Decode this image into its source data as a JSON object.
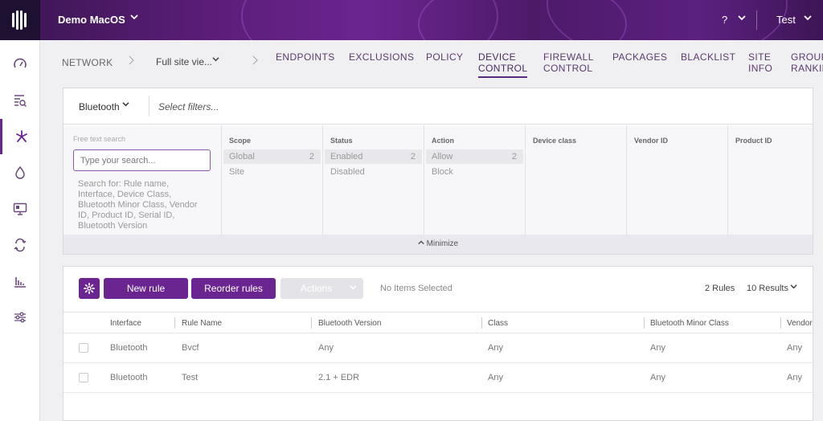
{
  "topbar": {
    "site_name": "Demo MacOS",
    "help": "?",
    "user": "Test"
  },
  "sidebar": {
    "items": [
      {
        "icon": "dashboard-gauge-icon"
      },
      {
        "icon": "search-list-icon"
      },
      {
        "icon": "sentinel-asterisk-icon",
        "active": true
      },
      {
        "icon": "droplet-icon"
      },
      {
        "icon": "monitor-icon"
      },
      {
        "icon": "sync-arrows-icon"
      },
      {
        "icon": "bar-chart-icon"
      },
      {
        "icon": "sliders-icon"
      }
    ]
  },
  "nav": {
    "network": "NETWORK",
    "site_selector": "Full site vie...",
    "tabs": [
      {
        "line1": "ENDPOINTS",
        "line2": ""
      },
      {
        "line1": "EXCLUSIONS",
        "line2": ""
      },
      {
        "line1": "POLICY",
        "line2": ""
      },
      {
        "line1": "DEVICE",
        "line2": "CONTROL",
        "active": true
      },
      {
        "line1": "FIREWALL",
        "line2": "CONTROL"
      },
      {
        "line1": "PACKAGES",
        "line2": ""
      },
      {
        "line1": "BLACKLIST",
        "line2": ""
      },
      {
        "line1": "SITE",
        "line2": "INFO"
      },
      {
        "line1": "GROUP",
        "line2": "RANKIN"
      }
    ]
  },
  "filters": {
    "interface_selector": "Bluetooth",
    "select_placeholder": "Select filters...",
    "free_text_label": "Free text search",
    "search_placeholder": "Type your search...",
    "search_help": "Search for: Rule name, Interface, Device Class, Bluetooth Minor Class, Vendor ID, Product ID, Serial ID, Bluetooth Version",
    "columns": {
      "scope": {
        "title": "Scope",
        "rows": [
          {
            "label": "Global",
            "count": "2",
            "selected": true
          },
          {
            "label": "Site",
            "count": ""
          }
        ]
      },
      "status": {
        "title": "Status",
        "rows": [
          {
            "label": "Enabled",
            "count": "2",
            "selected": true
          },
          {
            "label": "Disabled",
            "count": ""
          }
        ]
      },
      "action": {
        "title": "Action",
        "rows": [
          {
            "label": "Allow",
            "count": "2",
            "selected": true
          },
          {
            "label": "Block",
            "count": ""
          }
        ]
      },
      "device_class": {
        "title": "Device class"
      },
      "vendor_id": {
        "title": "Vendor ID"
      },
      "product_id": {
        "title": "Product ID"
      }
    },
    "minimize": "Minimize"
  },
  "toolbar": {
    "new_rule": "New rule",
    "reorder_rules": "Reorder rules",
    "actions": "Actions",
    "no_items": "No Items Selected",
    "rules_count": "2 Rules",
    "results": "10 Results"
  },
  "table": {
    "headers": [
      "Interface",
      "Rule Name",
      "Bluetooth Version",
      "Class",
      "Bluetooth Minor Class",
      "Vendor"
    ],
    "rows": [
      [
        "Bluetooth",
        "Bvcf",
        "Any",
        "Any",
        "Any",
        "Any"
      ],
      [
        "Bluetooth",
        "Test",
        "2.1 + EDR",
        "Any",
        "Any",
        "Any"
      ]
    ]
  },
  "colors": {
    "accent": "#6b2590",
    "topbar": "#5a1d78"
  }
}
